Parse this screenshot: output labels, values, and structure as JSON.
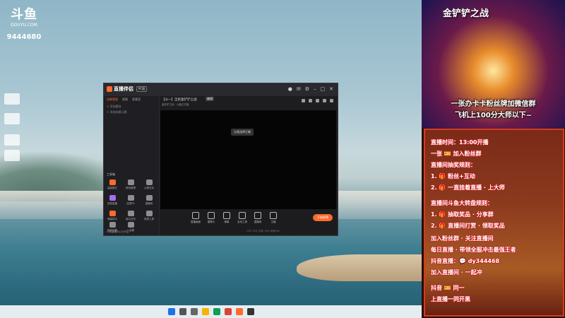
{
  "desktop": {
    "logo_brand": "斗鱼",
    "logo_site": "DOUYU.COM",
    "room_id": "9444680"
  },
  "app": {
    "name": "直播伴侣",
    "badge": "PC版",
    "left_tabs": [
      "场景管理",
      "视频",
      "背景音"
    ],
    "left_items": [
      "+ 添加素材",
      "+ 添加场景元素"
    ],
    "tools_label": "工具箱",
    "tools": [
      "高能模式",
      "房间管理",
      "公屏互动",
      "语音直播",
      "连麦PK",
      "直播间",
      "弹幕助手",
      "鱼丸任务",
      "录屏工具",
      "房间设置",
      "一起看"
    ],
    "footer_note": "小鱼直播中心已开启",
    "room_title": "【斗一】全民金铲铲之战",
    "room_tag": "编辑",
    "room_sub": "金铲铲之战 · 斗鱼正式版",
    "preview_toast": "分类选择正确",
    "bottom_tools": [
      "直播画面",
      "摄像头",
      "弹幕",
      "互动工具",
      "直播间",
      "主播"
    ],
    "go_live": "开始直播",
    "status": "CPU 12%  内存 35%  帧率 60"
  },
  "overlay": {
    "banner_title": "金铲铲之战",
    "banner_line1": "一张办卡卡粉丝牌加微信群",
    "banner_line2": "飞机上100分大师以下~",
    "lines": [
      "直播时间：13:00开播",
      "一张 🎫 加入粉丝群",
      "直播间抽奖规则：",
      "1. 🎁 粉丝+互动",
      "2. 🎁 一直挂着直播 · 上大师",
      "直播间斗鱼大转盘规则：",
      "1. 🎁 抽取奖品 · 分享群",
      "2. 🎁 直播间打赏 · 领取奖品",
      "加入粉丝群 · 关注直播间",
      "每日直播 · 带领全服冲击最强王者",
      "抖音直播：💬 dy344468",
      "加入直播间 · 一起冲",
      "抖音 🎫 同一",
      "上直播一同开黑"
    ]
  }
}
